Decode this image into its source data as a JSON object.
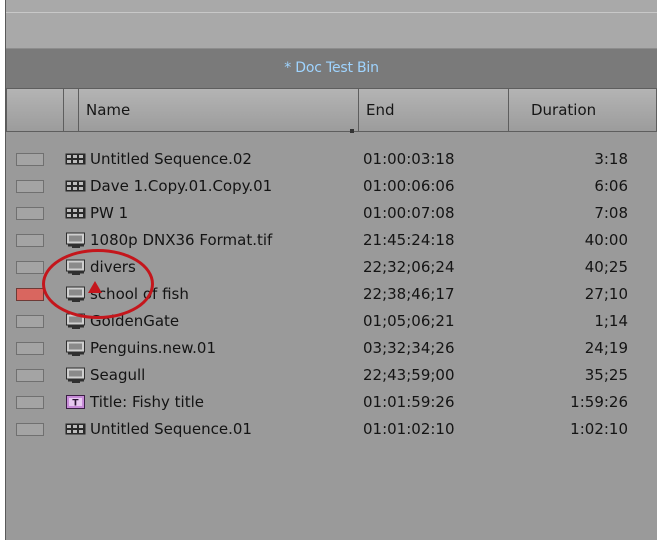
{
  "bin": {
    "title": "* Doc Test Bin"
  },
  "columns": {
    "name": "Name",
    "end": "End",
    "duration": "Duration"
  },
  "rows": [
    {
      "name": "Untitled Sequence.02",
      "end": "01:00:03:18",
      "duration": "3:18",
      "icon": "sequence-icon",
      "color": ""
    },
    {
      "name": "Dave 1.Copy.01.Copy.01",
      "end": "01:00:06:06",
      "duration": "6:06",
      "icon": "sequence-icon",
      "color": ""
    },
    {
      "name": "PW 1",
      "end": "01:00:07:08",
      "duration": "7:08",
      "icon": "sequence-icon",
      "color": ""
    },
    {
      "name": "1080p DNX36 Format.tif",
      "end": "21:45:24:18",
      "duration": "40:00",
      "icon": "master-clip-icon",
      "color": ""
    },
    {
      "name": "divers",
      "end": "22;32;06;24",
      "duration": "40;25",
      "icon": "master-clip-icon",
      "color": ""
    },
    {
      "name": "school of fish",
      "end": "22;38;46;17",
      "duration": "27;10",
      "icon": "master-clip-icon",
      "color": "#d9665f"
    },
    {
      "name": "GoldenGate",
      "end": "01;05;06;21",
      "duration": "1;14",
      "icon": "master-clip-icon",
      "color": ""
    },
    {
      "name": "Penguins.new.01",
      "end": "03;32;34;26",
      "duration": "24;19",
      "icon": "master-clip-icon",
      "color": ""
    },
    {
      "name": "Seagull",
      "end": "22;43;59;00",
      "duration": "35;25",
      "icon": "master-clip-icon",
      "color": ""
    },
    {
      "name": "Title: Fishy title",
      "end": "01:01:59:26",
      "duration": "1:59:26",
      "icon": "title-icon",
      "color": ""
    },
    {
      "name": "Untitled Sequence.01",
      "end": "01:01:02:10",
      "duration": "1:02:10",
      "icon": "sequence-icon",
      "color": ""
    }
  ],
  "colors": {
    "title_text": "#9fd4ff",
    "callout": "#c4161c",
    "warning": "#c4161c",
    "red_label": "#d9665f"
  }
}
